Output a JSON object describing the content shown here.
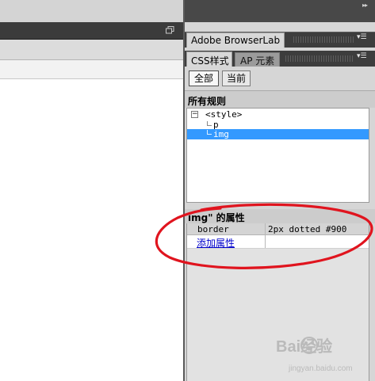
{
  "left_pane": {
    "restore_icon": "restore-window-icon"
  },
  "browserlab_panel": {
    "tab_label": "Adobe BrowserLab",
    "menu_icon": "panel-menu-icon"
  },
  "css_panel": {
    "tabs": [
      {
        "label": "CSS样式",
        "active": true
      },
      {
        "label": "AP 元素",
        "active": false
      }
    ],
    "mode_buttons": [
      {
        "label": "全部",
        "active": true
      },
      {
        "label": "当前",
        "active": false
      }
    ],
    "rules_section": {
      "title": "所有规则",
      "tree": [
        {
          "label": "<style>",
          "level": 0,
          "collapse_symbol": "−"
        },
        {
          "label": "p",
          "level": 1
        },
        {
          "label": "img",
          "level": 1,
          "selected": true
        }
      ]
    },
    "properties_section": {
      "title": "img\" 的属性",
      "rows": [
        {
          "name": "border",
          "value": "2px dotted #900"
        }
      ],
      "add_property_link": "添加属性"
    }
  },
  "colors": {
    "selection": "#3399ff",
    "annotation": "#e0141e",
    "link": "#0000cc"
  },
  "watermark": {
    "text": "Bai经验",
    "url": "jingyan.baidu.com"
  }
}
